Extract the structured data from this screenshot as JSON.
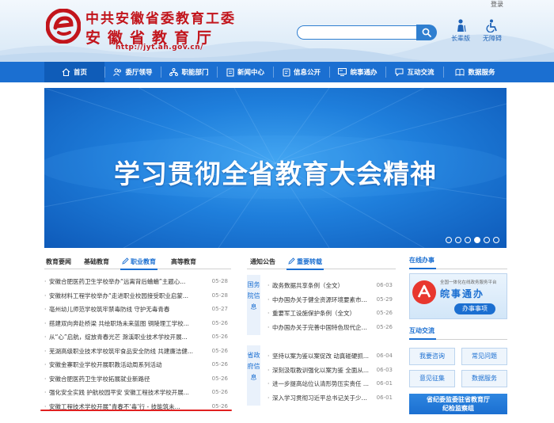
{
  "header": {
    "login": "登录",
    "title_line1": "中共安徽省委教育工委",
    "title_line2": "安徽省教育厅",
    "url": "http://jyt.ah.gov.cn/",
    "search_placeholder": "",
    "tools": [
      {
        "label": "长辈版",
        "icon": "elder-icon"
      },
      {
        "label": "无障碍",
        "icon": "accessibility-icon"
      }
    ]
  },
  "nav": {
    "items": [
      {
        "label": "首页",
        "icon": "home-icon"
      },
      {
        "label": "委厅领导",
        "icon": "leader-icon"
      },
      {
        "label": "职能部门",
        "icon": "department-icon"
      },
      {
        "label": "新闻中心",
        "icon": "news-icon"
      },
      {
        "label": "信息公开",
        "icon": "info-icon"
      },
      {
        "label": "皖事通办",
        "icon": "service-icon"
      },
      {
        "label": "互动交流",
        "icon": "chat-icon"
      },
      {
        "label": "数据服务",
        "icon": "data-icon"
      }
    ]
  },
  "banner": {
    "text": "学习贯彻全省教育大会精神",
    "slides": 6,
    "active_slide": 4
  },
  "col1": {
    "tabs": [
      "教育要闻",
      "基础教育",
      "职业教育",
      "高等教育"
    ],
    "active_tab": 2,
    "items": [
      {
        "title": "安徽合肥医药卫生学校举办“远离背后蛐蛐”主题心...",
        "date": "05-28"
      },
      {
        "title": "安徽材料工程学校举办“走进职业校园接受职业启蒙...",
        "date": "05-28"
      },
      {
        "title": "亳州幼儿师范学校筑牢禁毒防线 守护无毒青春",
        "date": "05-27"
      },
      {
        "title": "搭建双向奔赴桥梁 共绘职场未来蓝图 铜陵理工学校...",
        "date": "05-26"
      },
      {
        "title": "从“心”启航，绽放青春光芒 滁溪职业技术学校开展...",
        "date": "05-26"
      },
      {
        "title": "芜湖高级职业技术学校筑牢食品安全防线 共建廉洁健...",
        "date": "05-26"
      },
      {
        "title": "安徽金寨职业学校开展职教活动周系列活动",
        "date": "05-26"
      },
      {
        "title": "安徽合肥医药卫生学校拓展就业新路径",
        "date": "05-26"
      },
      {
        "title": "强化安全实践 护航校园平安 安徽工程技术学校开展...",
        "date": "05-26"
      },
      {
        "title": "安徽工程技术学校开展“青春不‘毒’行 - 技能筑未...",
        "date": "05-26"
      }
    ]
  },
  "col2": {
    "tabs": [
      "通知公告",
      "重要转载"
    ],
    "active_tab": 1,
    "groups": [
      {
        "label": "国务院信息",
        "items": [
          {
            "title": "政务数据共享条例（全文）",
            "date": "06-03"
          },
          {
            "title": "中办国办关于健全资源环境要素市场...",
            "date": "05-29"
          },
          {
            "title": "重要军工设施保护条例（全文）",
            "date": "05-26"
          },
          {
            "title": "中办国办关于完善中国特色现代企业...",
            "date": "05-26"
          }
        ]
      },
      {
        "label": "省政府信息",
        "items": [
          {
            "title": "坚持以案为鉴以案促改 动真碰硬抓...",
            "date": "06-04"
          },
          {
            "title": "深刻汲取教训强化以案为鉴 全面从...",
            "date": "06-03"
          },
          {
            "title": "进一步提高站位认清形势压实责任 ...",
            "date": "06-01"
          },
          {
            "title": "深入学习贯彻习近平总书记关于少年...",
            "date": "06-01"
          }
        ]
      }
    ]
  },
  "col3": {
    "online_title": "在线办事",
    "banner_sub": "全国一体化在线政务服务平台",
    "banner_title": "皖事通办",
    "banner_btn": "办事事项",
    "interact_title": "互动交流",
    "buttons": [
      "我要咨询",
      "常见问题",
      "意见征集",
      "数据服务"
    ],
    "anti_line1": "省纪委监委驻省教育厅",
    "anti_line2": "纪检监察组"
  }
}
